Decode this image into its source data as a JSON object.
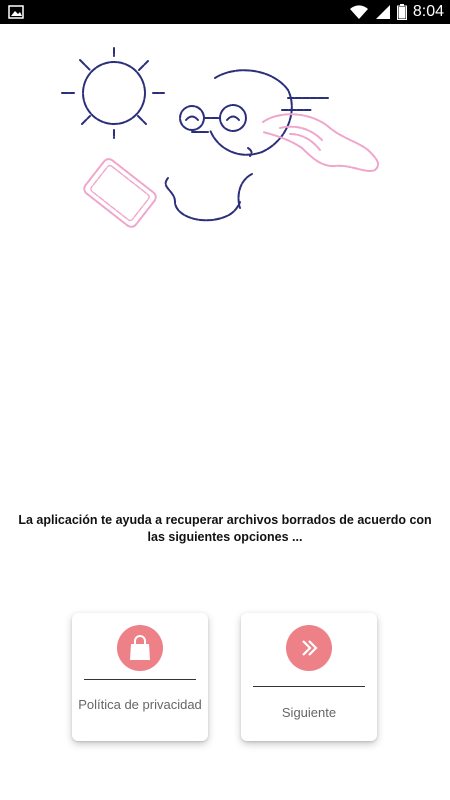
{
  "status_bar": {
    "time": "8:04",
    "icons": [
      "image-notification-icon",
      "wifi-icon",
      "signal-icon",
      "battery-icon"
    ]
  },
  "illustration": {
    "name": "girl-with-sun-and-phone-illustration",
    "colors": {
      "navy": "#2b2f7a",
      "pink": "#f0a6cc"
    }
  },
  "message": "La aplicación te ayuda a recuperar archivos borrados de acuerdo con las siguientes opciones ...",
  "cards": {
    "privacy": {
      "label": "Política de privacidad",
      "icon": "shopping-bag-icon"
    },
    "next": {
      "label": "Siguiente",
      "icon": "double-chevron-right-icon"
    }
  },
  "colors": {
    "accent": "#ee8088",
    "text": "#111111",
    "label": "#666666",
    "status_bar": "#000000"
  }
}
